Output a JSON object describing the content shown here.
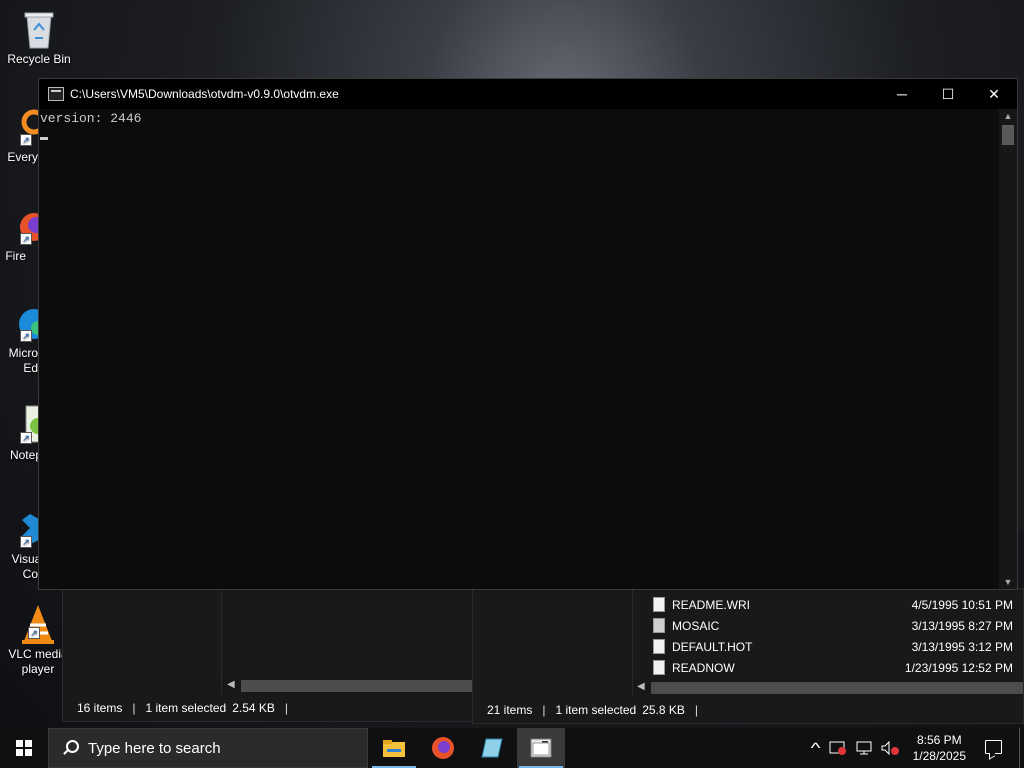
{
  "desktop": {
    "icons": [
      {
        "label": "Recycle Bin",
        "icon": "recycle-bin-icon"
      },
      {
        "label": "Every",
        "icon": "everything-search-icon"
      },
      {
        "label": "Fire",
        "icon": "firefox-icon"
      },
      {
        "label": "Micro",
        "label2": "Ed",
        "icon": "edge-icon"
      },
      {
        "label": "Notep",
        "icon": "notepad-plus-plus-icon"
      },
      {
        "label": "Visual",
        "label2": "Co",
        "icon": "vscode-icon"
      },
      {
        "label": "VLC media",
        "label2": "player",
        "icon": "vlc-icon"
      }
    ]
  },
  "console": {
    "title": "C:\\Users\\VM5\\Downloads\\otvdm-v0.9.0\\otvdm.exe",
    "output_line": "version: 2446",
    "minimize": "─",
    "maximize": "☐",
    "close": "✕"
  },
  "explorer_left": {
    "status": {
      "items": "16 items",
      "selected": "1 item selected",
      "size": "2.54 KB",
      "sep": "|"
    }
  },
  "explorer_right": {
    "files": [
      {
        "name": "README.WRI",
        "date": "4/5/1995 10:51 PM"
      },
      {
        "name": "MOSAIC",
        "date": "3/13/1995 8:27 PM"
      },
      {
        "name": "DEFAULT.HOT",
        "date": "3/13/1995 3:12 PM"
      },
      {
        "name": "READNOW",
        "date": "1/23/1995 12:52 PM"
      }
    ],
    "status": {
      "items": "21 items",
      "selected": "1 item selected",
      "size": "25.8 KB",
      "sep": "|"
    }
  },
  "taskbar": {
    "search_placeholder": "Type here to search",
    "apps": [
      "file-explorer-icon",
      "firefox-icon",
      "notepad-icon",
      "console-icon"
    ],
    "clock_time": "8:56 PM",
    "clock_date": "1/28/2025",
    "tray_chevron": "^"
  }
}
